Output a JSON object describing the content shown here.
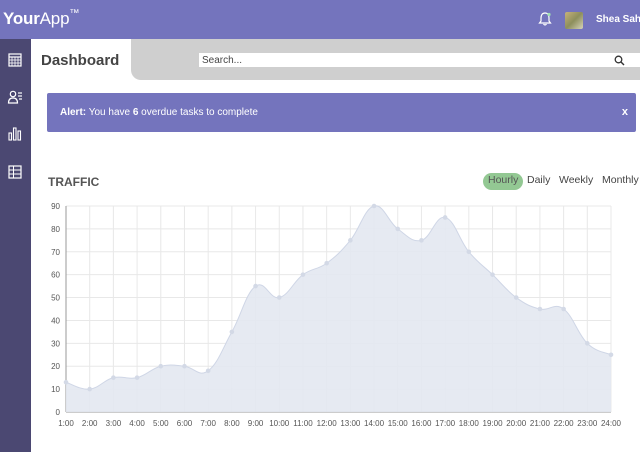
{
  "app": {
    "brand_bold": "Your",
    "brand_rest": "App",
    "brand_mark": "™"
  },
  "header": {
    "username": "Shea Sah"
  },
  "page": {
    "title": "Dashboard"
  },
  "search": {
    "placeholder": "Search..."
  },
  "alert": {
    "label": "Alert:",
    "text_before": " You have ",
    "count": "6",
    "text_after": " overdue tasks to complete",
    "close": "x"
  },
  "traffic": {
    "title": "TRAFFIC",
    "ranges": [
      "Hourly",
      "Daily",
      "Weekly",
      "Monthly"
    ],
    "active_range": "Hourly"
  },
  "colors": {
    "accent": "#7474bd",
    "sidebar": "#4b4872",
    "area_fill": "#e3e8f1",
    "active_tab": "#93c893"
  },
  "chart_data": {
    "type": "area",
    "x": [
      "1:00",
      "2:00",
      "3:00",
      "4:00",
      "5:00",
      "6:00",
      "7:00",
      "8:00",
      "9:00",
      "10:00",
      "11:00",
      "12:00",
      "13:00",
      "14:00",
      "15:00",
      "16:00",
      "17:00",
      "18:00",
      "19:00",
      "20:00",
      "21:00",
      "22:00",
      "23:00",
      "24:00"
    ],
    "values": [
      13,
      10,
      15,
      15,
      20,
      20,
      18,
      35,
      55,
      50,
      60,
      65,
      75,
      90,
      80,
      75,
      85,
      70,
      60,
      50,
      45,
      45,
      30,
      25
    ],
    "yticks": [
      0,
      10,
      20,
      30,
      40,
      50,
      60,
      70,
      80,
      90
    ],
    "ylim": [
      0,
      90
    ],
    "grid": true
  }
}
